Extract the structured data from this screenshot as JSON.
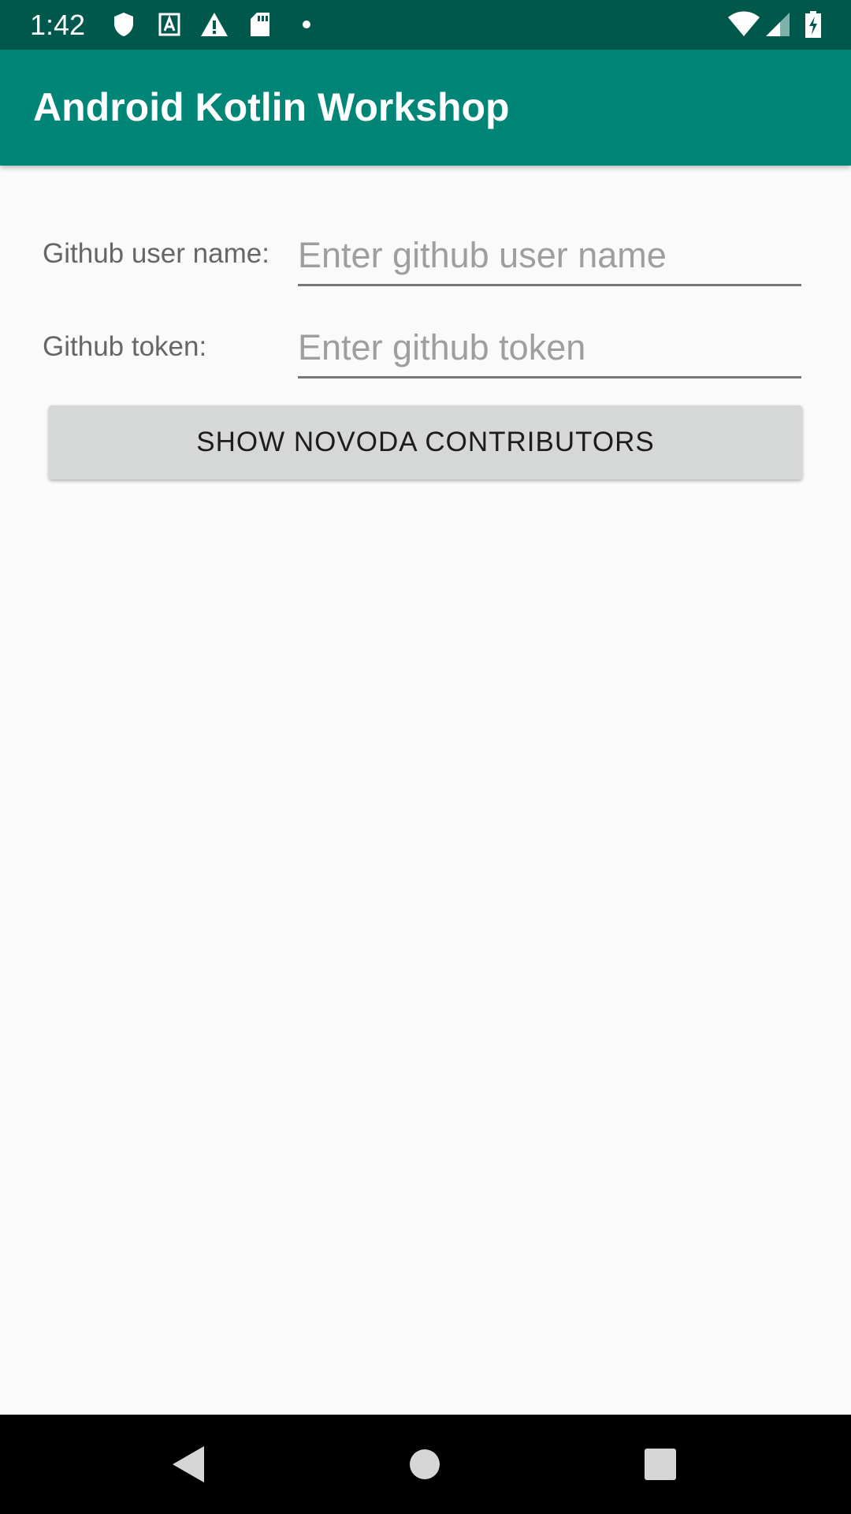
{
  "status_bar": {
    "time": "1:42",
    "left_icons": [
      "shield-icon",
      "text-a-icon",
      "warning-icon",
      "sd-card-icon",
      "dot-icon"
    ],
    "right_icons": [
      "wifi-icon",
      "cell-signal-icon",
      "battery-charging-icon"
    ]
  },
  "app_bar": {
    "title": "Android Kotlin Workshop",
    "color": "#008577"
  },
  "form": {
    "username_label": "Github user name:",
    "username_placeholder": "Enter github user name",
    "token_label": "Github token:",
    "token_placeholder": "Enter github token"
  },
  "actions": {
    "show_contributors_label": "SHOW NOVODA CONTRIBUTORS"
  },
  "nav_bar": {
    "buttons": [
      "back-icon",
      "home-icon",
      "recents-icon"
    ]
  }
}
